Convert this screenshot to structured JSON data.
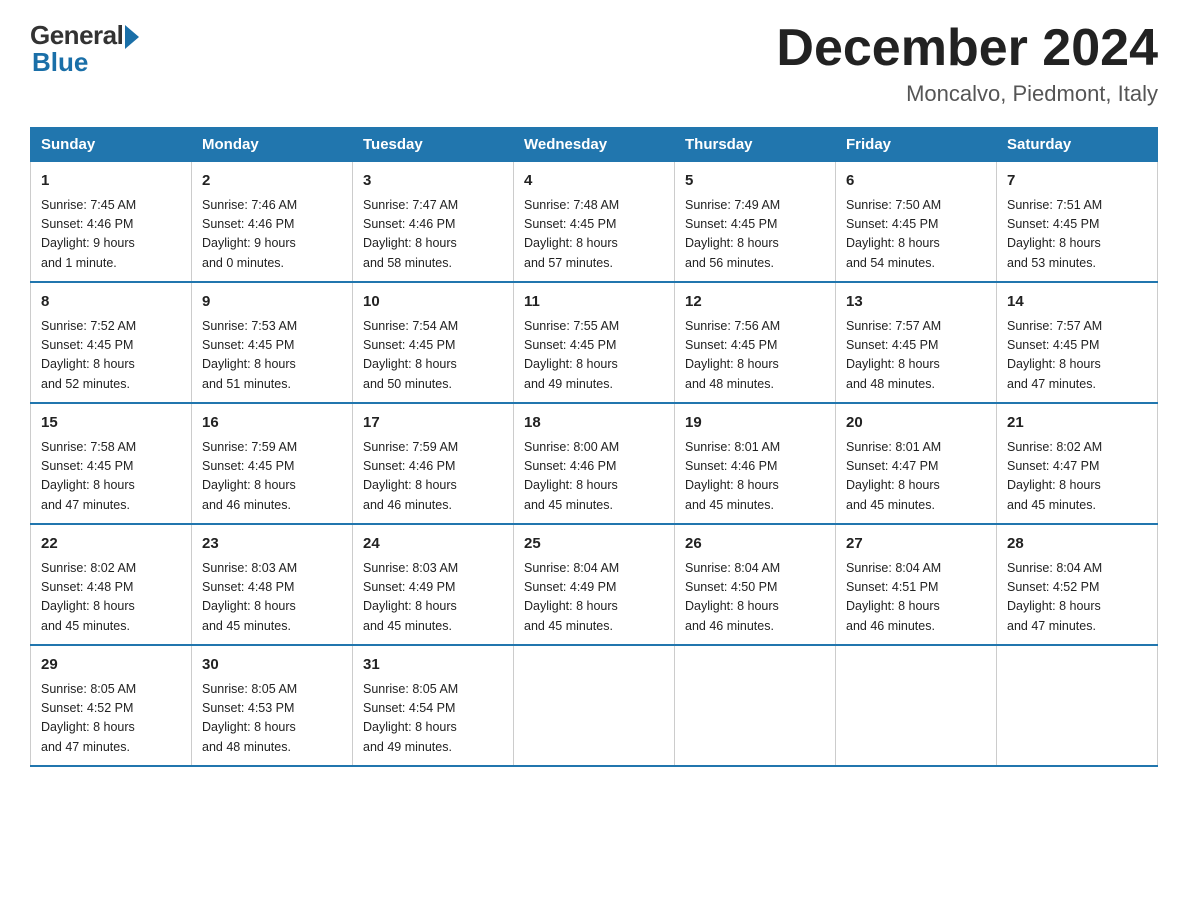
{
  "logo": {
    "general": "General",
    "blue": "Blue"
  },
  "title": "December 2024",
  "location": "Moncalvo, Piedmont, Italy",
  "days_of_week": [
    "Sunday",
    "Monday",
    "Tuesday",
    "Wednesday",
    "Thursday",
    "Friday",
    "Saturday"
  ],
  "weeks": [
    [
      {
        "num": "1",
        "info": "Sunrise: 7:45 AM\nSunset: 4:46 PM\nDaylight: 9 hours\nand 1 minute."
      },
      {
        "num": "2",
        "info": "Sunrise: 7:46 AM\nSunset: 4:46 PM\nDaylight: 9 hours\nand 0 minutes."
      },
      {
        "num": "3",
        "info": "Sunrise: 7:47 AM\nSunset: 4:46 PM\nDaylight: 8 hours\nand 58 minutes."
      },
      {
        "num": "4",
        "info": "Sunrise: 7:48 AM\nSunset: 4:45 PM\nDaylight: 8 hours\nand 57 minutes."
      },
      {
        "num": "5",
        "info": "Sunrise: 7:49 AM\nSunset: 4:45 PM\nDaylight: 8 hours\nand 56 minutes."
      },
      {
        "num": "6",
        "info": "Sunrise: 7:50 AM\nSunset: 4:45 PM\nDaylight: 8 hours\nand 54 minutes."
      },
      {
        "num": "7",
        "info": "Sunrise: 7:51 AM\nSunset: 4:45 PM\nDaylight: 8 hours\nand 53 minutes."
      }
    ],
    [
      {
        "num": "8",
        "info": "Sunrise: 7:52 AM\nSunset: 4:45 PM\nDaylight: 8 hours\nand 52 minutes."
      },
      {
        "num": "9",
        "info": "Sunrise: 7:53 AM\nSunset: 4:45 PM\nDaylight: 8 hours\nand 51 minutes."
      },
      {
        "num": "10",
        "info": "Sunrise: 7:54 AM\nSunset: 4:45 PM\nDaylight: 8 hours\nand 50 minutes."
      },
      {
        "num": "11",
        "info": "Sunrise: 7:55 AM\nSunset: 4:45 PM\nDaylight: 8 hours\nand 49 minutes."
      },
      {
        "num": "12",
        "info": "Sunrise: 7:56 AM\nSunset: 4:45 PM\nDaylight: 8 hours\nand 48 minutes."
      },
      {
        "num": "13",
        "info": "Sunrise: 7:57 AM\nSunset: 4:45 PM\nDaylight: 8 hours\nand 48 minutes."
      },
      {
        "num": "14",
        "info": "Sunrise: 7:57 AM\nSunset: 4:45 PM\nDaylight: 8 hours\nand 47 minutes."
      }
    ],
    [
      {
        "num": "15",
        "info": "Sunrise: 7:58 AM\nSunset: 4:45 PM\nDaylight: 8 hours\nand 47 minutes."
      },
      {
        "num": "16",
        "info": "Sunrise: 7:59 AM\nSunset: 4:45 PM\nDaylight: 8 hours\nand 46 minutes."
      },
      {
        "num": "17",
        "info": "Sunrise: 7:59 AM\nSunset: 4:46 PM\nDaylight: 8 hours\nand 46 minutes."
      },
      {
        "num": "18",
        "info": "Sunrise: 8:00 AM\nSunset: 4:46 PM\nDaylight: 8 hours\nand 45 minutes."
      },
      {
        "num": "19",
        "info": "Sunrise: 8:01 AM\nSunset: 4:46 PM\nDaylight: 8 hours\nand 45 minutes."
      },
      {
        "num": "20",
        "info": "Sunrise: 8:01 AM\nSunset: 4:47 PM\nDaylight: 8 hours\nand 45 minutes."
      },
      {
        "num": "21",
        "info": "Sunrise: 8:02 AM\nSunset: 4:47 PM\nDaylight: 8 hours\nand 45 minutes."
      }
    ],
    [
      {
        "num": "22",
        "info": "Sunrise: 8:02 AM\nSunset: 4:48 PM\nDaylight: 8 hours\nand 45 minutes."
      },
      {
        "num": "23",
        "info": "Sunrise: 8:03 AM\nSunset: 4:48 PM\nDaylight: 8 hours\nand 45 minutes."
      },
      {
        "num": "24",
        "info": "Sunrise: 8:03 AM\nSunset: 4:49 PM\nDaylight: 8 hours\nand 45 minutes."
      },
      {
        "num": "25",
        "info": "Sunrise: 8:04 AM\nSunset: 4:49 PM\nDaylight: 8 hours\nand 45 minutes."
      },
      {
        "num": "26",
        "info": "Sunrise: 8:04 AM\nSunset: 4:50 PM\nDaylight: 8 hours\nand 46 minutes."
      },
      {
        "num": "27",
        "info": "Sunrise: 8:04 AM\nSunset: 4:51 PM\nDaylight: 8 hours\nand 46 minutes."
      },
      {
        "num": "28",
        "info": "Sunrise: 8:04 AM\nSunset: 4:52 PM\nDaylight: 8 hours\nand 47 minutes."
      }
    ],
    [
      {
        "num": "29",
        "info": "Sunrise: 8:05 AM\nSunset: 4:52 PM\nDaylight: 8 hours\nand 47 minutes."
      },
      {
        "num": "30",
        "info": "Sunrise: 8:05 AM\nSunset: 4:53 PM\nDaylight: 8 hours\nand 48 minutes."
      },
      {
        "num": "31",
        "info": "Sunrise: 8:05 AM\nSunset: 4:54 PM\nDaylight: 8 hours\nand 49 minutes."
      },
      {
        "num": "",
        "info": ""
      },
      {
        "num": "",
        "info": ""
      },
      {
        "num": "",
        "info": ""
      },
      {
        "num": "",
        "info": ""
      }
    ]
  ]
}
